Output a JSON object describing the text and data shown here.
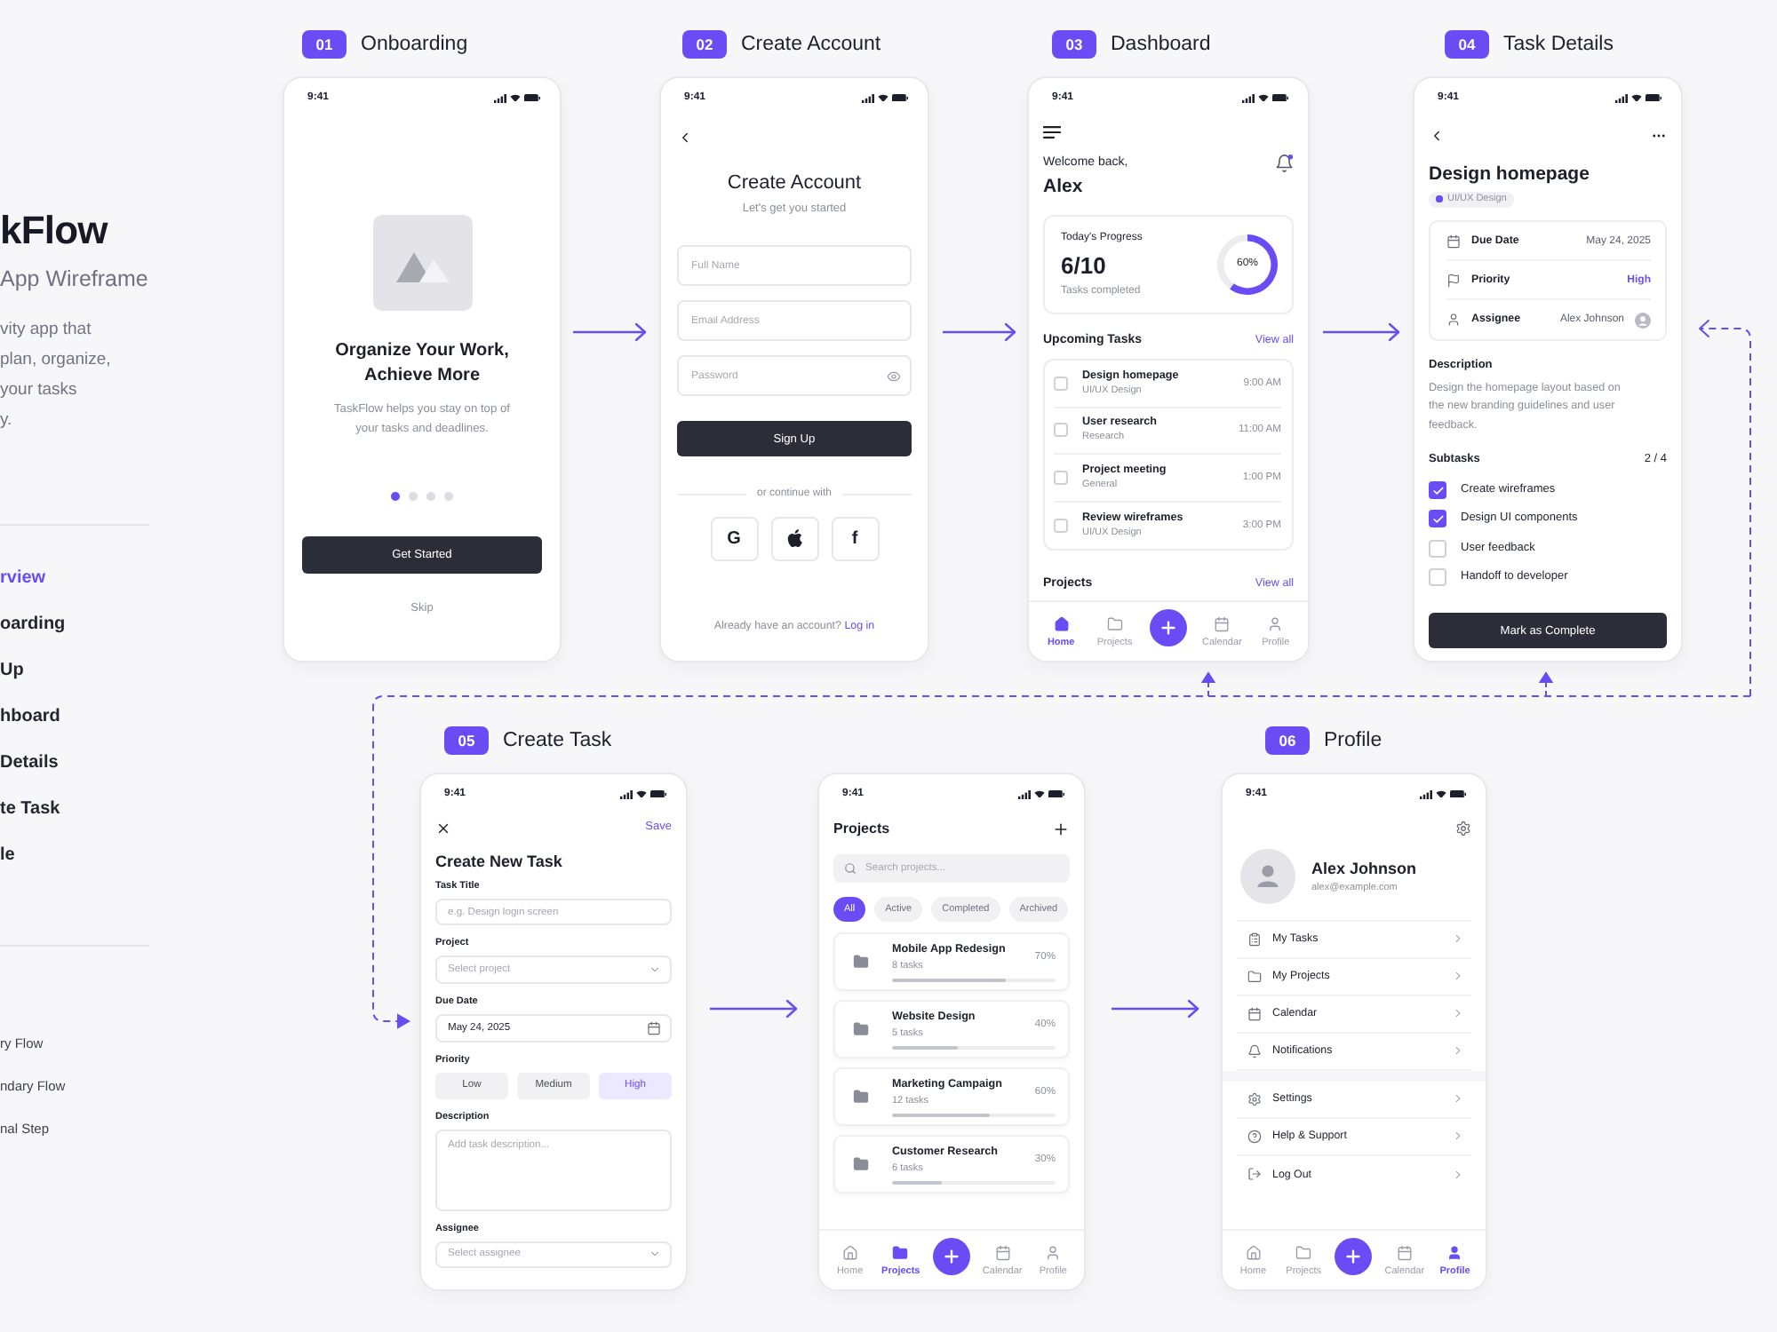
{
  "sidebar": {
    "title": "kFlow",
    "subtitle": "App Wireframe",
    "description_lines": [
      "vity app that",
      "plan, organize,",
      "your tasks",
      "y."
    ],
    "nav": [
      {
        "label": "rview",
        "selected": true
      },
      {
        "label": "oarding",
        "selected": false
      },
      {
        "label": "Up",
        "selected": false
      },
      {
        "label": "hboard",
        "selected": false
      },
      {
        "label": "Details",
        "selected": false
      },
      {
        "label": "te Task",
        "selected": false
      },
      {
        "label": "le",
        "selected": false
      }
    ],
    "legend": [
      {
        "label": "ry Flow"
      },
      {
        "label": "ndary Flow"
      },
      {
        "label": "nal Step"
      }
    ]
  },
  "screens": [
    {
      "kind": "onboarding",
      "step": {
        "number": "01",
        "title": "Onboarding"
      },
      "time": "9:41",
      "heading": "Organize Your Work, Achieve More",
      "body": "TaskFlow helps you stay on top of your tasks and deadlines.",
      "dots": [
        {
          "selected": true
        },
        {
          "selected": false
        },
        {
          "selected": false
        },
        {
          "selected": false
        }
      ],
      "button": "Get Started",
      "link": "Skip"
    },
    {
      "kind": "sign_up",
      "step": {
        "number": "02",
        "title": "Create Account"
      },
      "time": "9:41",
      "heading": "Create Account",
      "subheading": "Let's get you started",
      "fields": [
        {
          "kind": "text",
          "placeholder": "Full Name"
        },
        {
          "kind": "text",
          "placeholder": "Email Address"
        },
        {
          "kind": "password",
          "placeholder": "Password"
        }
      ],
      "button": "Sign Up",
      "divider": "or continue with",
      "social": [
        {
          "kind": "google",
          "glyph": "G"
        },
        {
          "kind": "apple"
        },
        {
          "kind": "facebook",
          "glyph": "f"
        }
      ],
      "footer": "Already have an account?",
      "footer_link": "Log in"
    },
    {
      "kind": "dashboard",
      "step": {
        "number": "03",
        "title": "Dashboard"
      },
      "time": "9:41",
      "greeting": "Welcome back,",
      "name": "Alex",
      "progress": {
        "title": "Today's Progress",
        "value": "6/10",
        "caption": "Tasks completed",
        "reading": "60%",
        "chart_data": {
          "type": "donut",
          "values": [
            60,
            40
          ]
        }
      },
      "upcoming": {
        "title": "Upcoming Tasks",
        "link": "View all",
        "tasks": [
          {
            "title": "Design homepage",
            "category": "UI/UX Design",
            "time": "9:00 AM",
            "checked": false
          },
          {
            "title": "User research",
            "category": "Research",
            "time": "11:00 AM",
            "checked": false
          },
          {
            "title": "Project meeting",
            "category": "General",
            "time": "1:00 PM",
            "checked": false
          },
          {
            "title": "Review wireframes",
            "category": "UI/UX Design",
            "time": "3:00 PM",
            "checked": false
          }
        ]
      },
      "projects": {
        "title": "Projects",
        "link": "View all"
      },
      "tabs": [
        {
          "kind": "home",
          "label": "Home",
          "selected": true
        },
        {
          "kind": "folder",
          "label": "Projects",
          "selected": false
        },
        {
          "kind": "calendar",
          "label": "Calendar",
          "selected": false
        },
        {
          "kind": "profile",
          "label": "Profile",
          "selected": false
        }
      ]
    },
    {
      "kind": "task_details",
      "step": {
        "number": "04",
        "title": "Task Details"
      },
      "time": "9:41",
      "heading": "Design homepage",
      "tag": {
        "label": "UI/UX Design"
      },
      "details": [
        {
          "kind": "date",
          "label": "Due Date",
          "value": "May 24, 2025"
        },
        {
          "kind": "priority",
          "label": "Priority",
          "value": "High"
        },
        {
          "kind": "person",
          "label": "Assignee",
          "value": "Alex Johnson"
        }
      ],
      "description_title": "Description",
      "description": "Design the homepage layout based on the new branding guidelines and user feedback.",
      "subtasks_title": "Subtasks",
      "subtasks_count": "2 / 4",
      "subtasks": [
        {
          "label": "Create wireframes",
          "checked": true
        },
        {
          "label": "Design UI components",
          "checked": true
        },
        {
          "label": "User feedback",
          "checked": false
        },
        {
          "label": "Handoff to developer",
          "checked": false
        }
      ],
      "button": "Mark as Complete"
    },
    {
      "kind": "create_task",
      "step": {
        "number": "05",
        "title": "Create Task"
      },
      "time": "9:41",
      "action": "Save",
      "heading": "Create New Task",
      "fields": [
        {
          "kind": "text",
          "label": "Task Title",
          "placeholder": "e.g. Design login screen"
        },
        {
          "kind": "select",
          "label": "Project",
          "placeholder": "Select project"
        },
        {
          "kind": "date",
          "label": "Due Date",
          "value": "May 24, 2025"
        },
        {
          "kind": "choice",
          "label": "Priority",
          "options": [
            {
              "label": "Low",
              "selected": false
            },
            {
              "label": "Medium",
              "selected": false
            },
            {
              "label": "High",
              "selected": true
            }
          ]
        },
        {
          "kind": "textarea",
          "label": "Description",
          "placeholder": "Add task description..."
        },
        {
          "kind": "select",
          "label": "Assignee",
          "placeholder": "Select assignee"
        }
      ]
    },
    {
      "kind": "projects",
      "time": "9:41",
      "heading": "Projects",
      "search": {
        "placeholder": "Search projects..."
      },
      "filters": [
        {
          "label": "All",
          "selected": true
        },
        {
          "label": "Active",
          "selected": false
        },
        {
          "label": "Completed",
          "selected": false
        },
        {
          "label": "Archived",
          "selected": false
        }
      ],
      "projects": [
        {
          "name": "Mobile App Redesign",
          "count": "8 tasks",
          "reading": "70%",
          "level": 0.7
        },
        {
          "name": "Website Design",
          "count": "5 tasks",
          "reading": "40%",
          "level": 0.4
        },
        {
          "name": "Marketing Campaign",
          "count": "12 tasks",
          "reading": "60%",
          "level": 0.6
        },
        {
          "name": "Customer Research",
          "count": "6 tasks",
          "reading": "30%",
          "level": 0.3
        }
      ],
      "tabs": [
        {
          "kind": "home",
          "label": "Home",
          "selected": false
        },
        {
          "kind": "folder",
          "label": "Projects",
          "selected": true
        },
        {
          "kind": "calendar",
          "label": "Calendar",
          "selected": false
        },
        {
          "kind": "profile",
          "label": "Profile",
          "selected": false
        }
      ]
    },
    {
      "kind": "profile",
      "step": {
        "number": "06",
        "title": "Profile"
      },
      "time": "9:41",
      "name": "Alex Johnson",
      "email": "alex@example.com",
      "menu_sections": [
        {
          "items": [
            {
              "kind": "tasks",
              "label": "My Tasks"
            },
            {
              "kind": "folder",
              "label": "My Projects"
            },
            {
              "kind": "calendar",
              "label": "Calendar"
            },
            {
              "kind": "bell",
              "label": "Notifications"
            }
          ]
        },
        {
          "items": [
            {
              "kind": "settings",
              "label": "Settings"
            },
            {
              "kind": "help",
              "label": "Help & Support"
            },
            {
              "kind": "logout",
              "label": "Log Out"
            }
          ]
        }
      ],
      "tabs": [
        {
          "kind": "home",
          "label": "Home",
          "selected": false
        },
        {
          "kind": "folder",
          "label": "Projects",
          "selected": false
        },
        {
          "kind": "calendar",
          "label": "Calendar",
          "selected": false
        },
        {
          "kind": "profile",
          "label": "Profile",
          "selected": true
        }
      ]
    }
  ]
}
